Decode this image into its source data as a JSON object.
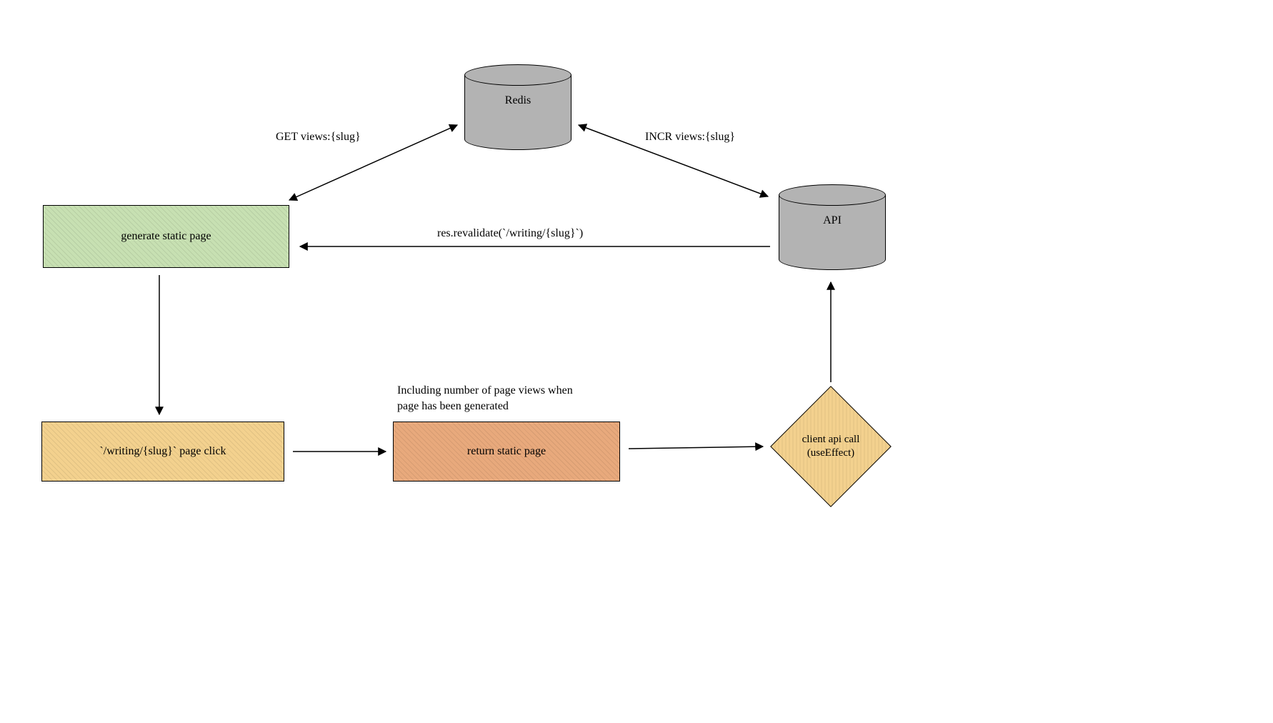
{
  "nodes": {
    "redis": {
      "label": "Redis"
    },
    "api": {
      "label": "API"
    },
    "generate_static": {
      "label": "generate static page"
    },
    "page_click": {
      "label": "`/writing/{slug}` page click"
    },
    "return_static": {
      "label": "return static page"
    },
    "client_api_call": {
      "label": "client api call\n(useEffect)"
    }
  },
  "edges": {
    "get_views": {
      "label": "GET views:{slug}"
    },
    "incr_views": {
      "label": "INCR views:{slug}"
    },
    "revalidate": {
      "label": "res.revalidate(`/writing/{slug}`)"
    },
    "including_note": {
      "label": "Including number of page views when\npage has been generated"
    }
  }
}
